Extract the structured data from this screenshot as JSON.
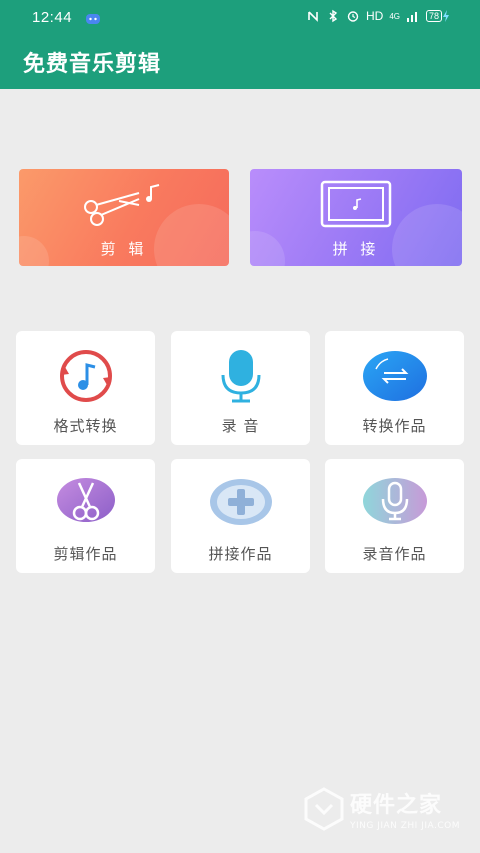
{
  "status_bar": {
    "time": "12:44",
    "network": "HD",
    "signal": "4G",
    "battery": "78"
  },
  "app": {
    "title": "免费音乐剪辑"
  },
  "cards": {
    "edit": {
      "label": "剪 辑"
    },
    "join": {
      "label": "拼 接"
    }
  },
  "tiles": [
    {
      "label": "格式转换",
      "icon": "format-convert-icon"
    },
    {
      "label": "录 音",
      "icon": "microphone-icon"
    },
    {
      "label": "转换作品",
      "icon": "converted-works-icon"
    },
    {
      "label": "剪辑作品",
      "icon": "scissors-icon"
    },
    {
      "label": "拼接作品",
      "icon": "plus-icon"
    },
    {
      "label": "录音作品",
      "icon": "recording-works-icon"
    }
  ],
  "watermark": {
    "title": "硬件之家",
    "subtitle": "YING JIAN ZHI JIA.COM"
  },
  "colors": {
    "header": "#1d9f7c",
    "background": "#ececec"
  }
}
